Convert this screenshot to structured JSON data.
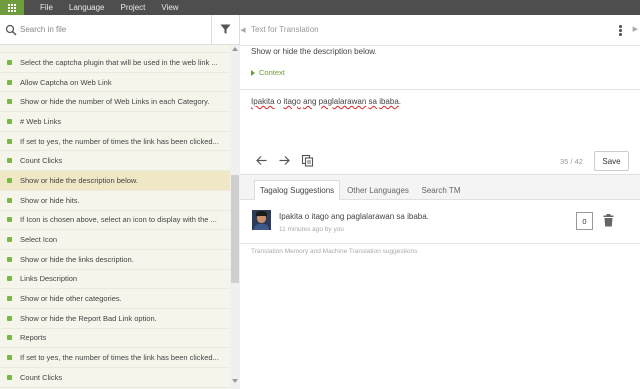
{
  "menu": {
    "items": [
      "File",
      "Language",
      "Project",
      "View"
    ],
    "accent": "#6f9c3d",
    "bar_color": "#4e4e4e",
    "icon": "grid-icon"
  },
  "sidebar": {
    "search_placeholder": "Search in file",
    "items": [
      {
        "label": "Select the captcha plugin that will be used in the web link ...",
        "selected": false
      },
      {
        "label": "Allow Captcha on Web Link",
        "selected": false
      },
      {
        "label": "Show or hide the number of Web Links in each Category.",
        "selected": false
      },
      {
        "label": "# Web Links",
        "selected": false
      },
      {
        "label": "If set to yes, the number of times the link has been clicked...",
        "selected": false
      },
      {
        "label": "Count Clicks",
        "selected": false
      },
      {
        "label": "Show or hide the description below.",
        "selected": true
      },
      {
        "label": "Show or hide hits.",
        "selected": false
      },
      {
        "label": "If Icon is chosen above, select an icon to display with the ...",
        "selected": false
      },
      {
        "label": "Select Icon",
        "selected": false
      },
      {
        "label": "Show or hide the links description.",
        "selected": false
      },
      {
        "label": "Links Description",
        "selected": false
      },
      {
        "label": "Show or hide other categories.",
        "selected": false
      },
      {
        "label": "Show or hide the Report Bad Link option.",
        "selected": false
      },
      {
        "label": "Reports",
        "selected": false
      },
      {
        "label": "If set to yes, the number of times the link has been clicked...",
        "selected": false
      },
      {
        "label": "Count Clicks",
        "selected": false
      }
    ],
    "status_color": "#7ab648",
    "selected_color": "#efe7c6"
  },
  "editor": {
    "header": "Text for Translation",
    "source_text": "Show or hide the description below.",
    "context_label": "Context",
    "translation_words": [
      {
        "w": "Ipakita",
        "spell": true
      },
      {
        "w": " o ",
        "spell": false
      },
      {
        "w": "itago",
        "spell": true
      },
      {
        "w": " ",
        "spell": false
      },
      {
        "w": "ang",
        "spell": true
      },
      {
        "w": " ",
        "spell": false
      },
      {
        "w": "paglalarawan",
        "spell": true
      },
      {
        "w": " ",
        "spell": false
      },
      {
        "w": "sa",
        "spell": true
      },
      {
        "w": " ",
        "spell": false
      },
      {
        "w": "ibaba",
        "spell": true
      },
      {
        "w": ".",
        "spell": false
      }
    ],
    "counter": "35 / 42",
    "save_label": "Save"
  },
  "suggestions": {
    "tabs": [
      "Tagalog Suggestions",
      "Other Languages",
      "Search TM"
    ],
    "active_tab": 0,
    "item": {
      "text": "Ipakita o itago ang paglalarawan sa ibaba.",
      "meta": "11 minutes ago by you",
      "votes": "0"
    },
    "note": "Translation Memory and Machine Translation suggestions"
  }
}
